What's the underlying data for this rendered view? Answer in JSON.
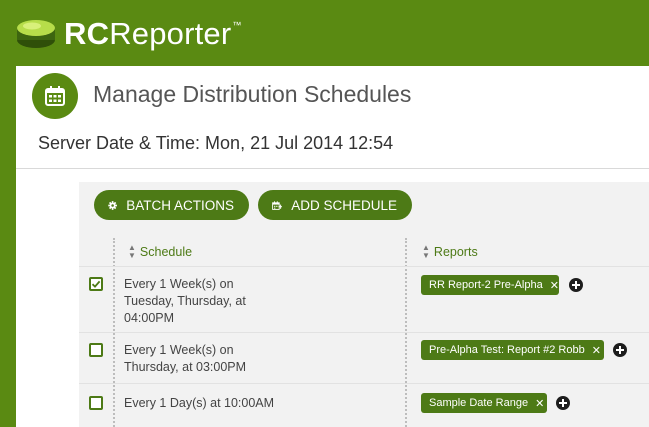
{
  "app": {
    "brand_bold": "RC",
    "brand_regular": "Reporter",
    "brand_tm": "™"
  },
  "page": {
    "title": "Manage Distribution Schedules",
    "server_time": "Server Date & Time: Mon, 21 Jul 2014 12:54"
  },
  "toolbar": {
    "batch_label": "BATCH ACTIONS",
    "add_label": "ADD SCHEDULE"
  },
  "table": {
    "headers": {
      "schedule": "Schedule",
      "reports": "Reports"
    },
    "rows": [
      {
        "checked": true,
        "schedule": [
          "Every 1 Week(s) on",
          "Tuesday, Thursday, at",
          "04:00PM"
        ],
        "report": "RR Report-2 Pre-Alpha"
      },
      {
        "checked": false,
        "schedule": [
          "Every 1 Week(s) on",
          "Thursday, at 03:00PM"
        ],
        "report": "Pre-Alpha Test: Report #2 Robb"
      },
      {
        "checked": false,
        "schedule": [
          "Every 1 Day(s) at 10:00AM"
        ],
        "report": "Sample Date Range"
      }
    ]
  },
  "icons": {
    "logo": "logo-icon",
    "title": "calendar-icon",
    "batch": "gear-icon",
    "add": "add-calendar-icon",
    "sort": "sort-icon",
    "check": "check-icon",
    "remove": "remove-icon",
    "add_report": "plus-circle-icon"
  },
  "colors": {
    "brand_green": "#5a8a12",
    "button_green": "#4d7a16",
    "panel_gray": "#f2f2f2"
  }
}
